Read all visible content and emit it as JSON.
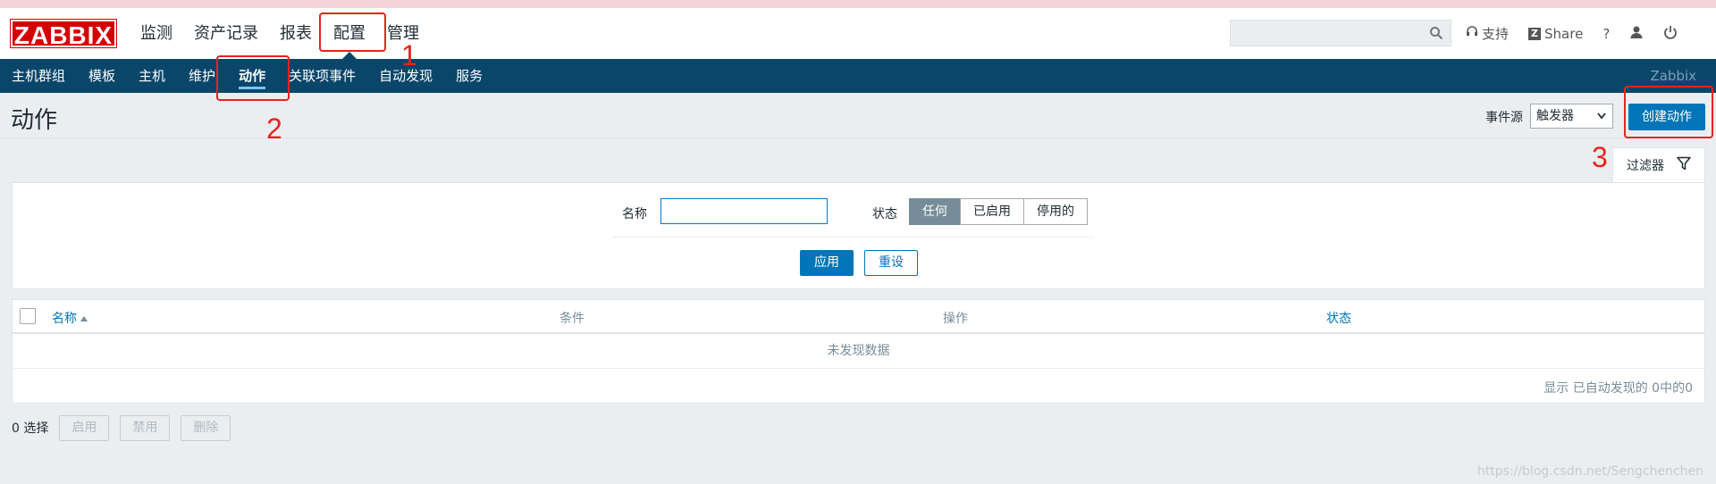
{
  "header": {
    "logo": "ZABBIX",
    "menu": [
      {
        "label": "监测"
      },
      {
        "label": "资产记录"
      },
      {
        "label": "报表"
      },
      {
        "label": "配置"
      },
      {
        "label": "管理"
      }
    ],
    "search_placeholder": "",
    "tools": {
      "support": "支持",
      "share": "Share",
      "help": "?"
    }
  },
  "subnav": {
    "items": [
      {
        "label": "主机群组"
      },
      {
        "label": "模板"
      },
      {
        "label": "主机"
      },
      {
        "label": "维护"
      },
      {
        "label": "动作"
      },
      {
        "label": "关联项事件"
      },
      {
        "label": "自动发现"
      },
      {
        "label": "服务"
      }
    ],
    "brand": "Zabbix"
  },
  "page": {
    "title": "动作",
    "event_source_label": "事件源",
    "event_source_value": "触发器",
    "create_button": "创建动作"
  },
  "filter": {
    "tab_label": "过滤器",
    "name_label": "名称",
    "name_value": "",
    "status_label": "状态",
    "status_options": [
      "任何",
      "已启用",
      "停用的"
    ],
    "status_selected": "任何",
    "apply": "应用",
    "reset": "重设"
  },
  "table": {
    "columns": [
      "名称",
      "条件",
      "操作",
      "状态"
    ],
    "empty_message": "未发现数据",
    "pager_text": "显示 已自动发现的 0中的0"
  },
  "mass_actions": {
    "selected_count": "0 选择",
    "enable": "启用",
    "disable": "禁用",
    "delete": "删除"
  },
  "annotations": [
    "1",
    "2",
    "3"
  ],
  "watermark": "https://blog.csdn.net/Sengchenchen",
  "colors": {
    "brand_red": "#d40000",
    "nav_blue": "#0a466a",
    "primary_button": "#0275b8",
    "annotation_red": "#e8231e"
  }
}
